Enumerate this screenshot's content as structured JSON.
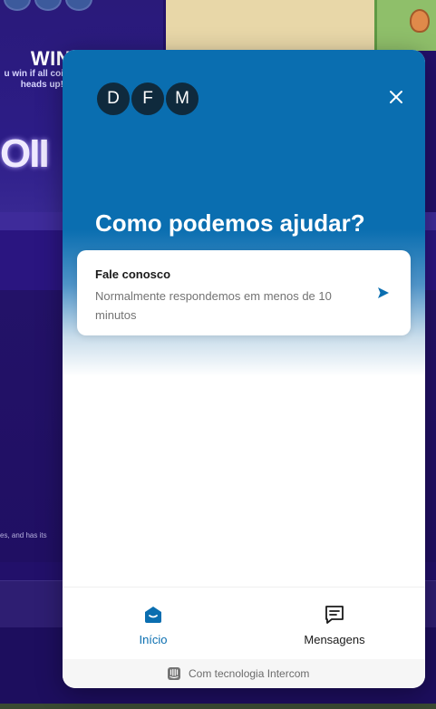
{
  "background": {
    "win_label": "WIN",
    "win_sub_line1": "u win if all coi",
    "win_sub_line2": "heads up!",
    "big_text": "OII",
    "fine_text": "es, and has its ",
    "colors": {
      "page": "#22106a",
      "band": "#2a1580",
      "strip": "#3e2b9a"
    }
  },
  "messenger": {
    "accent_color": "#0a6eb0",
    "avatars": [
      "D",
      "F",
      "M"
    ],
    "close_icon": "close-icon",
    "title": "Como podemos ajudar?",
    "contact_card": {
      "title": "Fale conosco",
      "subtitle": "Normalmente respondemos em menos de 10 minutos",
      "icon": "send-arrow-icon"
    },
    "nav": {
      "home_label": "Início",
      "home_icon": "home-icon",
      "messages_label": "Mensagens",
      "messages_icon": "chat-icon"
    },
    "footer": {
      "text": "Com tecnologia Intercom",
      "icon": "intercom-logo-icon"
    }
  }
}
